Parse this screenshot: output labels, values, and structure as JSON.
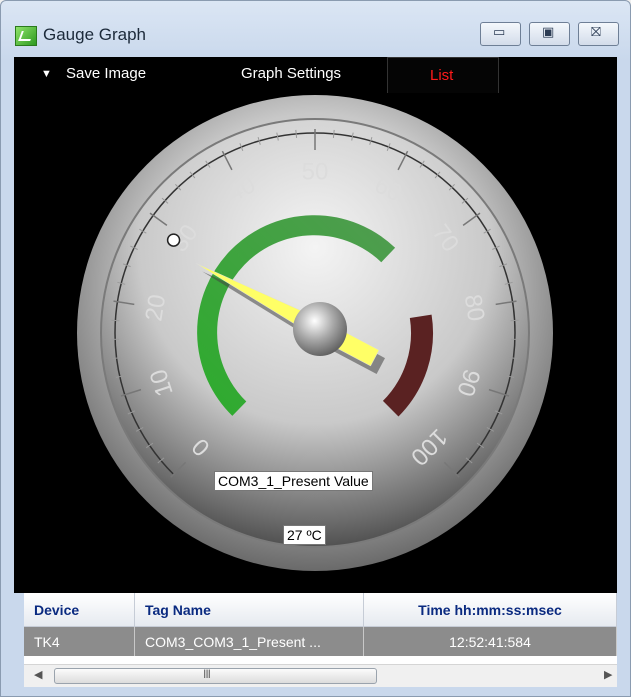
{
  "window": {
    "title": "Gauge Graph"
  },
  "window_buttons": {
    "minimize": "▭",
    "maximize": "▣",
    "close": "⛝"
  },
  "toolbar": {
    "save_label": "Save Image",
    "settings_label": "Graph Settings",
    "list_label": "List"
  },
  "gauge": {
    "min": 0,
    "max": 100,
    "scale_labels": [
      "0",
      "10",
      "20",
      "30",
      "40",
      "50",
      "60",
      "70",
      "80",
      "90",
      "100"
    ],
    "value": 27,
    "needle_value": 27,
    "tag_label": "COM3_1_Present Value",
    "value_label": "27 ºC",
    "zones": [
      {
        "from": 0,
        "to": 66,
        "color": "#3cb83c"
      },
      {
        "from": 80,
        "to": 100,
        "color": "#5a2222"
      }
    ],
    "colors": {
      "needle": "#ffff66",
      "green_zone": "#3cb83c",
      "red_zone": "#5a2222",
      "list_tab_text": "#ff1a1a"
    }
  },
  "table": {
    "headers": [
      "Device",
      "Tag Name",
      "Time hh:mm:ss:msec"
    ],
    "rows": [
      [
        "TK4",
        "COM3_COM3_1_Present ...",
        "12:52:41:584"
      ]
    ]
  },
  "scrollbar": {
    "thumb_grip": "III"
  }
}
